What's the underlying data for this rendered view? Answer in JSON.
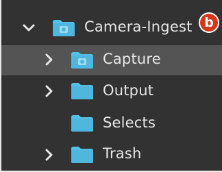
{
  "tree": {
    "items": [
      {
        "label": "Camera-Ingest",
        "icon": "folder-camera-icon",
        "expanded": true,
        "has_children": true,
        "selected": false
      },
      {
        "label": "Capture",
        "icon": "folder-camera-icon",
        "expanded": false,
        "has_children": true,
        "selected": true
      },
      {
        "label": "Output",
        "icon": "folder-icon",
        "expanded": false,
        "has_children": true,
        "selected": false
      },
      {
        "label": "Selects",
        "icon": "folder-icon",
        "expanded": false,
        "has_children": false,
        "selected": false
      },
      {
        "label": "Trash",
        "icon": "folder-icon",
        "expanded": false,
        "has_children": true,
        "selected": false
      }
    ]
  },
  "callout": {
    "label": "b",
    "color": "#d4371c"
  },
  "colors": {
    "background": "#323232",
    "selected_row": "#545454",
    "folder_body": "#55c0e6",
    "folder_tab": "#7fd0ee",
    "text": "#e6e6e6"
  }
}
